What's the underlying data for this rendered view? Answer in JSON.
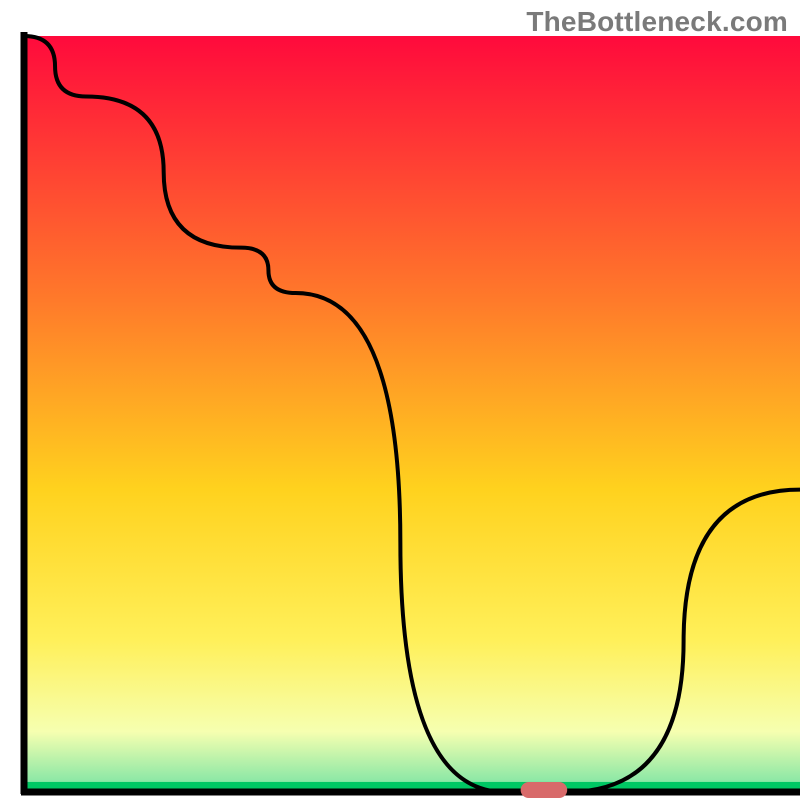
{
  "watermark": "TheBottleneck.com",
  "chart_data": {
    "type": "line",
    "title": "",
    "xlabel": "",
    "ylabel": "",
    "xlim": [
      0,
      100
    ],
    "ylim": [
      0,
      100
    ],
    "gradient_bands": [
      {
        "stop": 0.0,
        "color": "#ff0a3c"
      },
      {
        "stop": 0.35,
        "color": "#ff7a2a"
      },
      {
        "stop": 0.6,
        "color": "#ffd21e"
      },
      {
        "stop": 0.8,
        "color": "#fff05a"
      },
      {
        "stop": 0.92,
        "color": "#f6ffb0"
      },
      {
        "stop": 0.985,
        "color": "#8de8a6"
      },
      {
        "stop": 1.0,
        "color": "#00c864"
      }
    ],
    "series": [
      {
        "name": "bottleneck-curve",
        "x": [
          0,
          8,
          28,
          35,
          62,
          65,
          70,
          100
        ],
        "values": [
          100,
          92,
          72,
          66,
          0,
          0,
          0,
          40
        ]
      }
    ],
    "marker": {
      "name": "sweet-spot",
      "x": 67,
      "y": 0,
      "color": "#d86a6a",
      "width": 6,
      "height": 2.5
    },
    "axes": {
      "left": {
        "x": 3,
        "y1": 4,
        "y2": 100
      },
      "bottom": {
        "y": 100,
        "x1": 3,
        "x2": 100
      }
    }
  }
}
